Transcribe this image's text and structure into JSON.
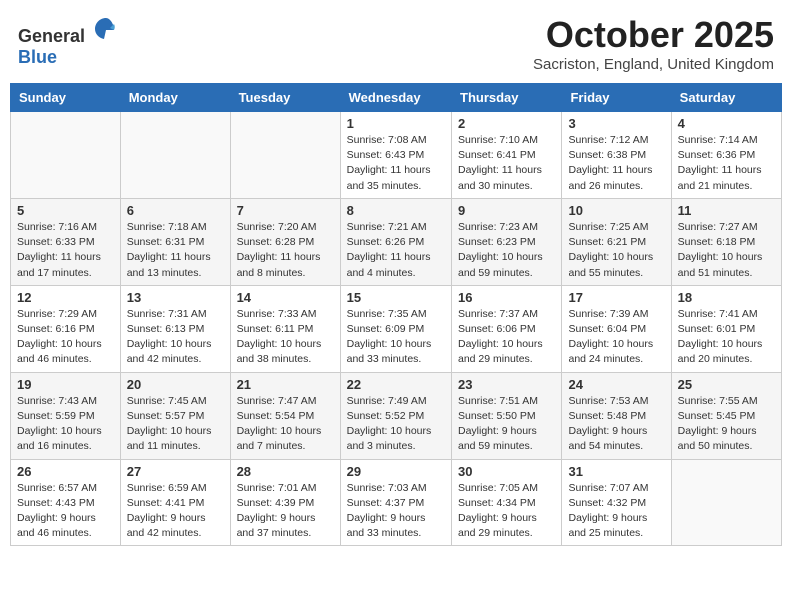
{
  "logo": {
    "text_general": "General",
    "text_blue": "Blue"
  },
  "title": "October 2025",
  "subtitle": "Sacriston, England, United Kingdom",
  "days_of_week": [
    "Sunday",
    "Monday",
    "Tuesday",
    "Wednesday",
    "Thursday",
    "Friday",
    "Saturday"
  ],
  "weeks": [
    [
      {
        "day": "",
        "info": ""
      },
      {
        "day": "",
        "info": ""
      },
      {
        "day": "",
        "info": ""
      },
      {
        "day": "1",
        "info": "Sunrise: 7:08 AM\nSunset: 6:43 PM\nDaylight: 11 hours\nand 35 minutes."
      },
      {
        "day": "2",
        "info": "Sunrise: 7:10 AM\nSunset: 6:41 PM\nDaylight: 11 hours\nand 30 minutes."
      },
      {
        "day": "3",
        "info": "Sunrise: 7:12 AM\nSunset: 6:38 PM\nDaylight: 11 hours\nand 26 minutes."
      },
      {
        "day": "4",
        "info": "Sunrise: 7:14 AM\nSunset: 6:36 PM\nDaylight: 11 hours\nand 21 minutes."
      }
    ],
    [
      {
        "day": "5",
        "info": "Sunrise: 7:16 AM\nSunset: 6:33 PM\nDaylight: 11 hours\nand 17 minutes."
      },
      {
        "day": "6",
        "info": "Sunrise: 7:18 AM\nSunset: 6:31 PM\nDaylight: 11 hours\nand 13 minutes."
      },
      {
        "day": "7",
        "info": "Sunrise: 7:20 AM\nSunset: 6:28 PM\nDaylight: 11 hours\nand 8 minutes."
      },
      {
        "day": "8",
        "info": "Sunrise: 7:21 AM\nSunset: 6:26 PM\nDaylight: 11 hours\nand 4 minutes."
      },
      {
        "day": "9",
        "info": "Sunrise: 7:23 AM\nSunset: 6:23 PM\nDaylight: 10 hours\nand 59 minutes."
      },
      {
        "day": "10",
        "info": "Sunrise: 7:25 AM\nSunset: 6:21 PM\nDaylight: 10 hours\nand 55 minutes."
      },
      {
        "day": "11",
        "info": "Sunrise: 7:27 AM\nSunset: 6:18 PM\nDaylight: 10 hours\nand 51 minutes."
      }
    ],
    [
      {
        "day": "12",
        "info": "Sunrise: 7:29 AM\nSunset: 6:16 PM\nDaylight: 10 hours\nand 46 minutes."
      },
      {
        "day": "13",
        "info": "Sunrise: 7:31 AM\nSunset: 6:13 PM\nDaylight: 10 hours\nand 42 minutes."
      },
      {
        "day": "14",
        "info": "Sunrise: 7:33 AM\nSunset: 6:11 PM\nDaylight: 10 hours\nand 38 minutes."
      },
      {
        "day": "15",
        "info": "Sunrise: 7:35 AM\nSunset: 6:09 PM\nDaylight: 10 hours\nand 33 minutes."
      },
      {
        "day": "16",
        "info": "Sunrise: 7:37 AM\nSunset: 6:06 PM\nDaylight: 10 hours\nand 29 minutes."
      },
      {
        "day": "17",
        "info": "Sunrise: 7:39 AM\nSunset: 6:04 PM\nDaylight: 10 hours\nand 24 minutes."
      },
      {
        "day": "18",
        "info": "Sunrise: 7:41 AM\nSunset: 6:01 PM\nDaylight: 10 hours\nand 20 minutes."
      }
    ],
    [
      {
        "day": "19",
        "info": "Sunrise: 7:43 AM\nSunset: 5:59 PM\nDaylight: 10 hours\nand 16 minutes."
      },
      {
        "day": "20",
        "info": "Sunrise: 7:45 AM\nSunset: 5:57 PM\nDaylight: 10 hours\nand 11 minutes."
      },
      {
        "day": "21",
        "info": "Sunrise: 7:47 AM\nSunset: 5:54 PM\nDaylight: 10 hours\nand 7 minutes."
      },
      {
        "day": "22",
        "info": "Sunrise: 7:49 AM\nSunset: 5:52 PM\nDaylight: 10 hours\nand 3 minutes."
      },
      {
        "day": "23",
        "info": "Sunrise: 7:51 AM\nSunset: 5:50 PM\nDaylight: 9 hours\nand 59 minutes."
      },
      {
        "day": "24",
        "info": "Sunrise: 7:53 AM\nSunset: 5:48 PM\nDaylight: 9 hours\nand 54 minutes."
      },
      {
        "day": "25",
        "info": "Sunrise: 7:55 AM\nSunset: 5:45 PM\nDaylight: 9 hours\nand 50 minutes."
      }
    ],
    [
      {
        "day": "26",
        "info": "Sunrise: 6:57 AM\nSunset: 4:43 PM\nDaylight: 9 hours\nand 46 minutes."
      },
      {
        "day": "27",
        "info": "Sunrise: 6:59 AM\nSunset: 4:41 PM\nDaylight: 9 hours\nand 42 minutes."
      },
      {
        "day": "28",
        "info": "Sunrise: 7:01 AM\nSunset: 4:39 PM\nDaylight: 9 hours\nand 37 minutes."
      },
      {
        "day": "29",
        "info": "Sunrise: 7:03 AM\nSunset: 4:37 PM\nDaylight: 9 hours\nand 33 minutes."
      },
      {
        "day": "30",
        "info": "Sunrise: 7:05 AM\nSunset: 4:34 PM\nDaylight: 9 hours\nand 29 minutes."
      },
      {
        "day": "31",
        "info": "Sunrise: 7:07 AM\nSunset: 4:32 PM\nDaylight: 9 hours\nand 25 minutes."
      },
      {
        "day": "",
        "info": ""
      }
    ]
  ]
}
